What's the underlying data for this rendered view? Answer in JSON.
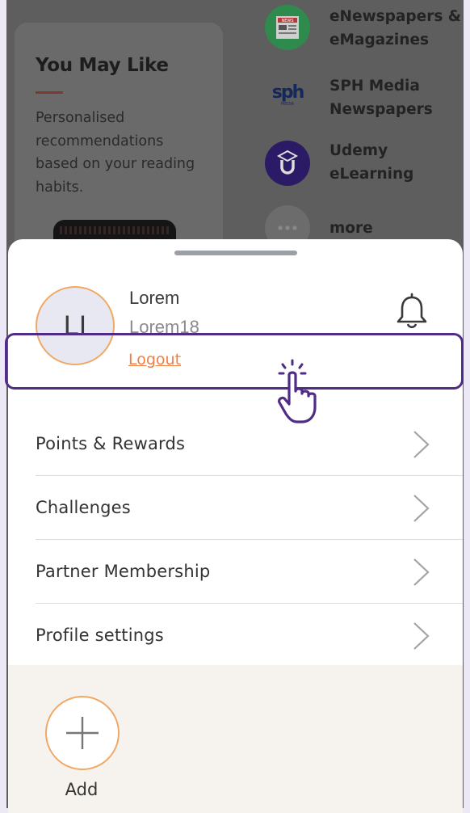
{
  "background": {
    "you_may_like": {
      "title": "You May Like",
      "description": "Personalised recommendations based on your reading habits."
    },
    "apps": [
      {
        "label": "eNewspapers & eMagazines",
        "icon": "newspaper-icon"
      },
      {
        "label": "SPH Media Newspapers",
        "icon": "sph-media-logo"
      },
      {
        "label": "Udemy eLearning",
        "icon": "udemy-logo"
      },
      {
        "label": "more",
        "icon": "more-dots-icon"
      }
    ],
    "sph_logo_text": "sph",
    "sph_logo_sub": "MEDIA",
    "news_badge": "NEWS"
  },
  "profile": {
    "avatar_initials": "LI",
    "name": "Lorem",
    "username": "Lorem18",
    "logout_label": "Logout"
  },
  "menu": [
    {
      "label": "Points & Rewards"
    },
    {
      "label": "Challenges"
    },
    {
      "label": "Partner Membership"
    },
    {
      "label": "Profile settings"
    }
  ],
  "footer": {
    "add_label": "Add"
  },
  "colors": {
    "accent_orange": "#f07f46",
    "avatar_ring": "#f0a865",
    "highlight": "#4f2c86",
    "udemy_purple": "#3b1f8c",
    "news_green": "#3aa35c"
  }
}
